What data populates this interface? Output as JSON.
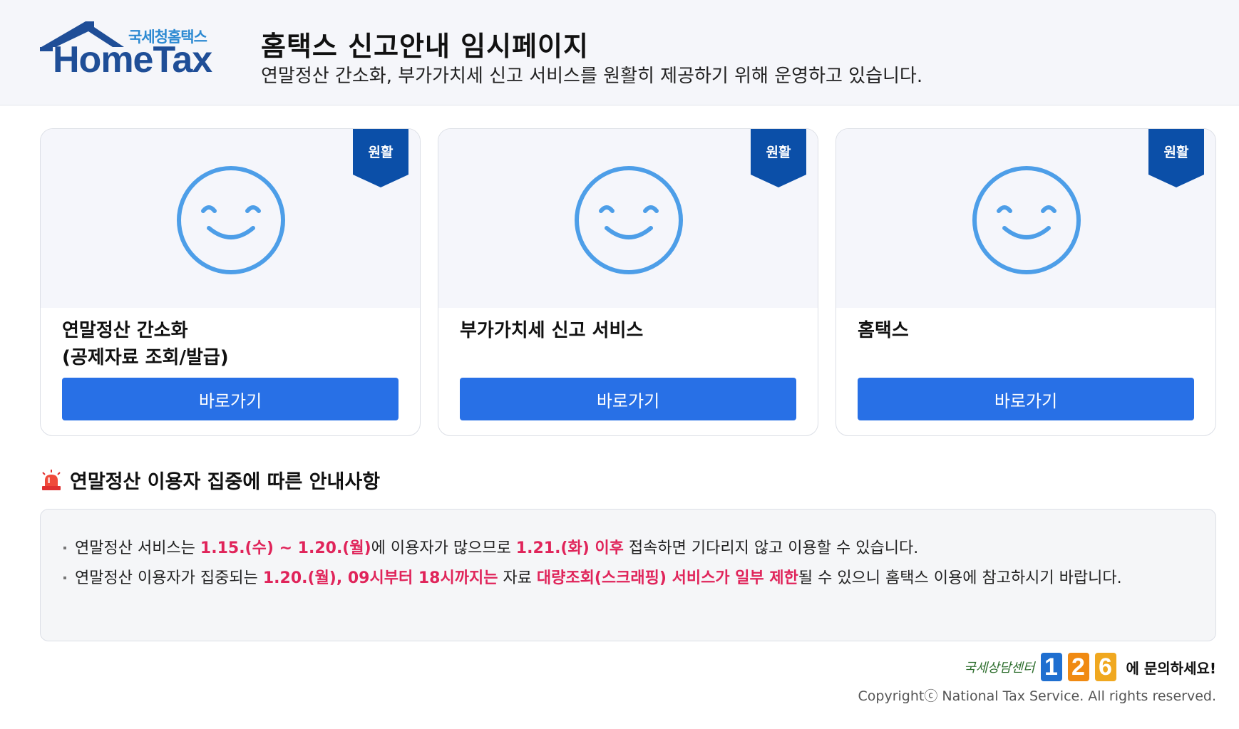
{
  "header": {
    "logo": {
      "sub_text": "국세청홈택스",
      "main_text": "HomeTax"
    },
    "title": "홈택스 신고안내 임시페이지",
    "description": "연말정산 간소화, 부가가치세 신고 서비스를 원활히 제공하기 위해 운영하고 있습니다."
  },
  "cards": [
    {
      "status_badge": "원활",
      "title_line1": "연말정산 간소화",
      "title_line2": "(공제자료 조회/발급)",
      "button_label": "바로가기"
    },
    {
      "status_badge": "원활",
      "title_line1": "부가가치세 신고 서비스",
      "title_line2": "",
      "button_label": "바로가기"
    },
    {
      "status_badge": "원활",
      "title_line1": "홈택스",
      "title_line2": "",
      "button_label": "바로가기"
    }
  ],
  "notice": {
    "title": "연말정산 이용자 집중에 따른 안내사항",
    "item1": {
      "part1": "연말정산 서비스는 ",
      "hl1": "1.15.(수) ~ 1.20.(월)",
      "part2": "에 이용자가 많으므로 ",
      "hl2": "1.21.(화) 이후",
      "part3": " 접속하면 기다리지 않고 이용할 수 있습니다."
    },
    "item2": {
      "part1": "연말정산 이용자가 집중되는 ",
      "hl1": "1.20.(월), 09시부터 18시까지는",
      "part2": " 자료 ",
      "hl2": "대량조회(스크래핑) 서비스가 일부 제한",
      "part3": "될 수 있으니 홈택스 이용에 참고하시기 바랍니다."
    }
  },
  "footer": {
    "contact_prefix": "국세상담센터",
    "digit1": "1",
    "digit2": "2",
    "digit3": "6",
    "contact_suffix": "에 문의하세요!",
    "copyright": "Copyrightⓒ National Tax Service. All rights reserved."
  },
  "colors": {
    "accent_blue": "#2870e6",
    "ribbon_blue": "#0b4fa8",
    "smiley_blue": "#4d9ee8",
    "highlight_red": "#e0245a",
    "digit1_color": "#1f6fd0",
    "digit2_color": "#f08a12",
    "digit3_color": "#f0a820"
  },
  "icons": {
    "card_status": "smiley-face-icon",
    "notice": "siren-icon"
  }
}
